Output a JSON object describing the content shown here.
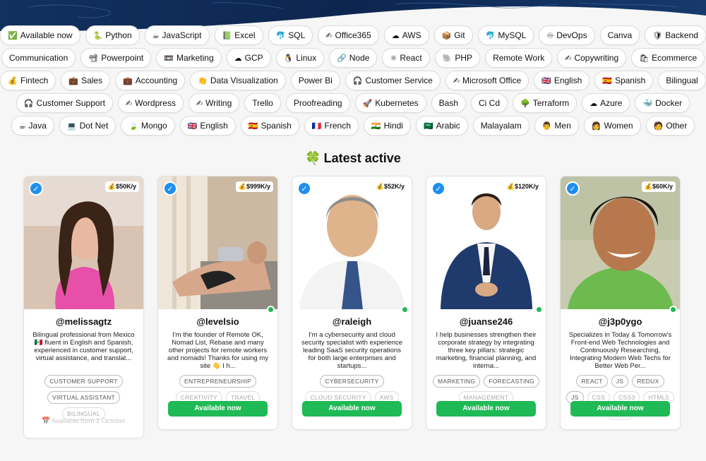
{
  "tag_rows": [
    [
      {
        "icon": "✅",
        "label": "Available now"
      },
      {
        "icon": "🐍",
        "label": "Python"
      },
      {
        "icon": "☕",
        "label": "JavaScript"
      },
      {
        "icon": "📗",
        "label": "Excel"
      },
      {
        "icon": "🐬",
        "label": "SQL"
      },
      {
        "icon": "✍",
        "label": "Office365"
      },
      {
        "icon": "☁",
        "label": "AWS"
      },
      {
        "icon": "📦",
        "label": "Git"
      },
      {
        "icon": "🐬",
        "label": "MySQL"
      },
      {
        "icon": "♾",
        "label": "DevOps"
      },
      {
        "icon": "",
        "label": "Canva"
      },
      {
        "icon": "🛡",
        "label": "Backend"
      }
    ],
    [
      {
        "icon": "",
        "label": "Communication"
      },
      {
        "icon": "📽",
        "label": "Powerpoint"
      },
      {
        "icon": "📼",
        "label": "Marketing"
      },
      {
        "icon": "☁",
        "label": "GCP"
      },
      {
        "icon": "🐧",
        "label": "Linux"
      },
      {
        "icon": "🔗",
        "label": "Node"
      },
      {
        "icon": "⚛",
        "label": "React"
      },
      {
        "icon": "🐘",
        "label": "PHP"
      },
      {
        "icon": "",
        "label": "Remote Work"
      },
      {
        "icon": "✍",
        "label": "Copywriting"
      },
      {
        "icon": "🛍",
        "label": "Ecommerce"
      }
    ],
    [
      {
        "icon": "💰",
        "label": "Fintech"
      },
      {
        "icon": "💼",
        "label": "Sales"
      },
      {
        "icon": "💼",
        "label": "Accounting"
      },
      {
        "icon": "👏",
        "label": "Data Visualization"
      },
      {
        "icon": "",
        "label": "Power Bi"
      },
      {
        "icon": "🎧",
        "label": "Customer Service"
      },
      {
        "icon": "✍",
        "label": "Microsoft Office"
      },
      {
        "icon": "🇬🇧",
        "label": "English"
      },
      {
        "icon": "🇪🇸",
        "label": "Spanish"
      },
      {
        "icon": "",
        "label": "Bilingual"
      }
    ],
    [
      {
        "icon": "🎧",
        "label": "Customer Support"
      },
      {
        "icon": "✍",
        "label": "Wordpress"
      },
      {
        "icon": "✍",
        "label": "Writing"
      },
      {
        "icon": "",
        "label": "Trello"
      },
      {
        "icon": "",
        "label": "Proofreading"
      },
      {
        "icon": "🚀",
        "label": "Kubernetes"
      },
      {
        "icon": "",
        "label": "Bash"
      },
      {
        "icon": "",
        "label": "Ci Cd"
      },
      {
        "icon": "🌳",
        "label": "Terraform"
      },
      {
        "icon": "☁",
        "label": "Azure"
      },
      {
        "icon": "🐳",
        "label": "Docker"
      }
    ],
    [
      {
        "icon": "☕",
        "label": "Java"
      },
      {
        "icon": "💻",
        "label": "Dot Net"
      },
      {
        "icon": "🍃",
        "label": "Mongo"
      },
      {
        "icon": "🇬🇧",
        "label": "English"
      },
      {
        "icon": "🇪🇸",
        "label": "Spanish"
      },
      {
        "icon": "🇫🇷",
        "label": "French"
      },
      {
        "icon": "🇮🇳",
        "label": "Hindi"
      },
      {
        "icon": "🇸🇦",
        "label": "Arabic"
      },
      {
        "icon": "",
        "label": "Malayalam"
      },
      {
        "icon": "👨",
        "label": "Men"
      },
      {
        "icon": "👩",
        "label": "Women"
      },
      {
        "icon": "🧑",
        "label": "Other"
      }
    ]
  ],
  "section": {
    "icon": "🍀",
    "title": "Latest active"
  },
  "cards": [
    {
      "handle": "@melissagtz",
      "salary": "💰$50K/y",
      "bio": "Bilingual professional from Mexico 🇲🇽 fluent in English and Spanish, experienced in customer support, virtual assistance, and translat...",
      "skills": [
        "CUSTOMER SUPPORT",
        "VIRTUAL ASSISTANT",
        "BILINGUAL"
      ],
      "available_from": "📅 Available from 1 October",
      "button": ""
    },
    {
      "handle": "@levelsio",
      "salary": "💰$999K/y",
      "bio": "I'm the founder of Remote OK, Nomad List, Rebase and many other projects for remote workers and nomads! Thanks for using my site 👋 I h...",
      "skills": [
        "ENTREPRENEURSHIP",
        "CREATIVITY",
        "TRAVEL"
      ],
      "available_from": "",
      "button": "Available now"
    },
    {
      "handle": "@raleigh",
      "salary": "💰$52K/y",
      "bio": "I'm a cybersecurity and cloud security specialist with experience leading SaaS security operations for both large enterprises and startups...",
      "skills": [
        "CYBERSECURITY",
        "CLOUD SECURITY",
        "AWS"
      ],
      "available_from": "",
      "button": "Available now"
    },
    {
      "handle": "@juanse246",
      "salary": "💰$120K/y",
      "bio": "I help businesses strengthen their corporate strategy by integrating three key pillars: strategic marketing, financial planning, and interna...",
      "skills": [
        "MARKETING",
        "FORECASTING",
        "MANAGEMENT"
      ],
      "available_from": "",
      "button": "Available now"
    },
    {
      "handle": "@j3p0ygo",
      "salary": "💰$60K/y",
      "bio": "Specializes in Today & Tomorrow's Front-end Web Technologies and Continuously Researching, Integrating Modern Web Techs for Better Web Per...",
      "skills": [
        "REACT",
        "JS",
        "REDUX",
        "JS",
        "CSS",
        "CSS3",
        "HTML5",
        "SASS"
      ],
      "available_from": "",
      "button": "Available now"
    }
  ],
  "colors": {
    "accent_green": "#1fba55",
    "verified_blue": "#1d8ff0",
    "hero_navy": "#0f2a52"
  }
}
